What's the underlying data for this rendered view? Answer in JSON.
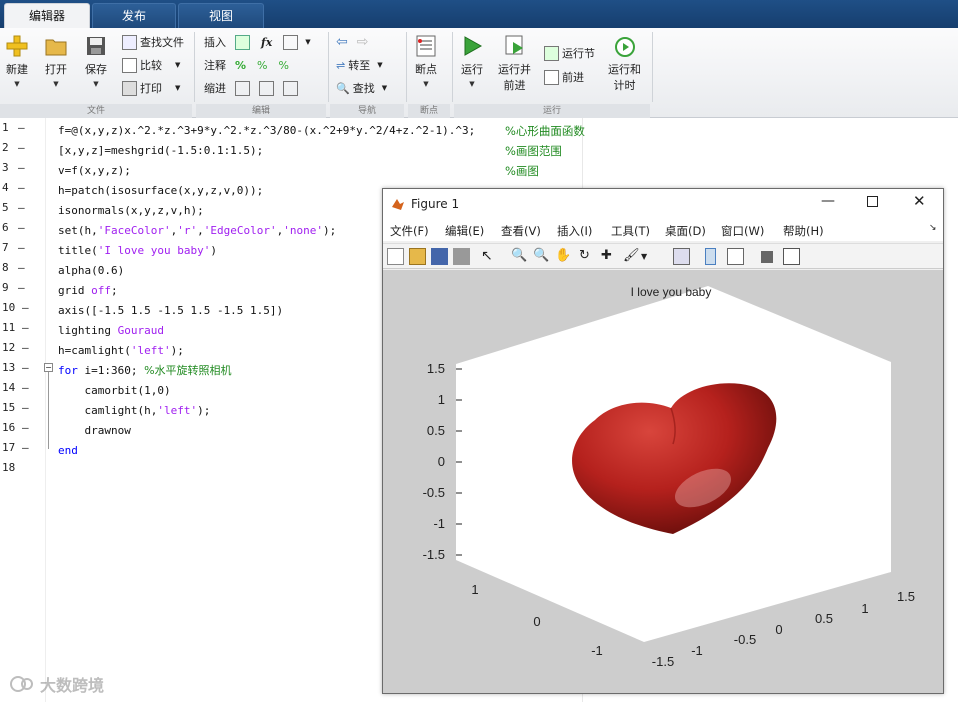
{
  "tabs": [
    {
      "label": "编辑器"
    },
    {
      "label": "发布"
    },
    {
      "label": "视图"
    }
  ],
  "ribbon": {
    "file": {
      "new": "新建",
      "open": "打开",
      "save": "保存",
      "find_files": "查找文件",
      "compare": "比较",
      "print": "打印",
      "group": "文件"
    },
    "edit": {
      "insert": "插入",
      "comment": "注释",
      "indent": "缩进",
      "group": "编辑"
    },
    "nav": {
      "goto": "转至",
      "find": "查找",
      "group": "导航"
    },
    "breakpoints": {
      "label": "断点",
      "group": "断点"
    },
    "run": {
      "run": "运行",
      "run_advance": "运行并\n前进",
      "run_section": "运行节",
      "advance": "前进",
      "run_time": "运行和\n计时",
      "group": "运行"
    }
  },
  "editor": {
    "lines": [
      {
        "n": "1",
        "code": "f=@(x,y,z)x.^2.*z.^3+9*y.^2.*z.^3/80-(x.^2+9*y.^2/4+z.^2-1).^3;",
        "comment": "%心形曲面函数"
      },
      {
        "n": "2",
        "code": "[x,y,z]=meshgrid(-1.5:0.1:1.5);",
        "comment": "%画图范围"
      },
      {
        "n": "3",
        "code": "v=f(x,y,z);",
        "comment": "%画图"
      },
      {
        "n": "4",
        "code": "h=patch(isosurface(x,y,z,v,0));"
      },
      {
        "n": "5",
        "code": "isonormals(x,y,z,v,h);"
      },
      {
        "n": "6",
        "pre": "set(h,",
        "s1": "'FaceColor'",
        "m1": ",",
        "s2": "'r'",
        "m2": ",",
        "s3": "'EdgeColor'",
        "m3": ",",
        "s4": "'none'",
        "post": ");"
      },
      {
        "n": "7",
        "pre": "title(",
        "s1": "'I love you baby'",
        "post": ")"
      },
      {
        "n": "8",
        "code": "alpha(0.6)"
      },
      {
        "n": "9",
        "pre": "grid ",
        "kw": "off",
        "post": ";"
      },
      {
        "n": "10",
        "code": "axis([-1.5 1.5 -1.5 1.5 -1.5 1.5])"
      },
      {
        "n": "11",
        "pre": "lighting ",
        "kw": "Gouraud"
      },
      {
        "n": "12",
        "pre": "h=camlight(",
        "s1": "'left'",
        "post": ");"
      },
      {
        "n": "13",
        "kw": "for",
        "mid": " i=1:360; ",
        "cm": "%水平旋转照相机"
      },
      {
        "n": "14",
        "code": "    camorbit(1,0)"
      },
      {
        "n": "15",
        "pre": "    camlight(h,",
        "s1": "'left'",
        "post": ");"
      },
      {
        "n": "16",
        "code": "    drawnow"
      },
      {
        "n": "17",
        "kw": "end"
      },
      {
        "n": "18"
      }
    ]
  },
  "figure": {
    "title": "Figure 1",
    "menu": [
      "文件(F)",
      "编辑(E)",
      "查看(V)",
      "插入(I)",
      "工具(T)",
      "桌面(D)",
      "窗口(W)",
      "帮助(H)"
    ],
    "plot_title": "I love you baby",
    "z_ticks": [
      "1.5",
      "1",
      "0.5",
      "0",
      "-0.5",
      "-1",
      "-1.5"
    ],
    "x_ticks": [
      "-1.5",
      "-1",
      "-0.5",
      "0",
      "0.5",
      "1",
      "1.5"
    ],
    "y_ticks": [
      "1",
      "0",
      "-1"
    ],
    "surface_color": "#b5211d",
    "axis_range": [
      -1.5,
      1.5
    ],
    "grid": "off"
  },
  "watermark": "大数跨境"
}
